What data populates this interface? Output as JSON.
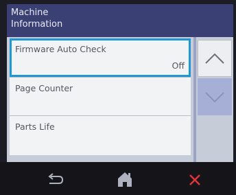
{
  "header": {
    "title": "Machine\nInformation"
  },
  "menu": {
    "items": [
      {
        "label": "Firmware Auto Check",
        "value": "Off"
      },
      {
        "label": "Page Counter"
      },
      {
        "label": "Parts Life"
      }
    ]
  },
  "scroll": {
    "up_icon": "chevron-up-icon",
    "down_icon": "chevron-down-icon"
  },
  "bottom_bar": {
    "back_icon": "back-arrow-icon",
    "home_icon": "home-icon",
    "cancel_icon": "close-icon"
  },
  "colors": {
    "header_bg": "#3a3f74",
    "selection_border": "#1e97d3",
    "cancel_red": "#e2343b"
  }
}
